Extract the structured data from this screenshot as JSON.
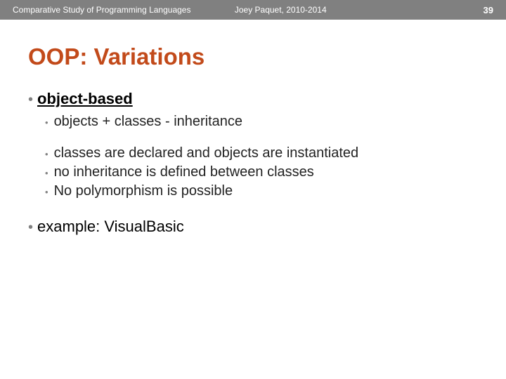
{
  "header": {
    "course": "Comparative Study of Programming Languages",
    "author": "Joey Paquet, 2010-2014",
    "page": "39"
  },
  "title": "OOP: Variations",
  "body": {
    "heading": "object-based",
    "sub1": "objects + classes - inheritance",
    "sub2": "classes are declared and objects are instantiated",
    "sub3": "no inheritance is defined between classes",
    "sub4": "No polymorphism is possible",
    "example": "example: VisualBasic"
  }
}
